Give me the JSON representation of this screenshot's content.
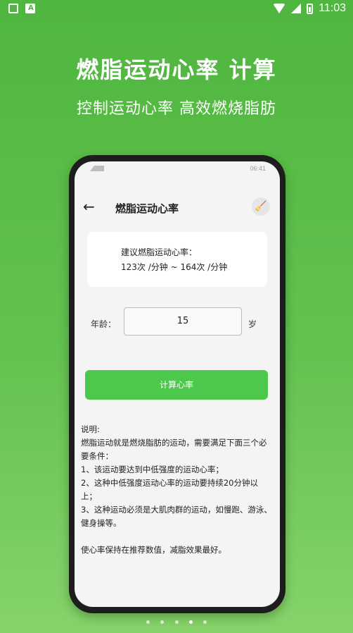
{
  "device": {
    "time": "11:03",
    "icons": [
      "cat-icon",
      "a-icon",
      "wifi-icon",
      "signal-icon",
      "battery-icon"
    ]
  },
  "banner": {
    "headline": "燃脂运动心率  计算",
    "subline": "控制运动心率    高效燃烧脂肪"
  },
  "phone": {
    "status_time": "06:41",
    "title": "燃脂运动心率",
    "suggest_label": "建议燃脂运动心率：",
    "suggest_value": "123次 /分钟 ~ 164次 /分钟",
    "age_label": "年龄：",
    "age_value": "15",
    "age_unit": "岁",
    "calc_button": "计算心率",
    "desc": [
      "说明:",
      "燃脂运动就是燃烧脂肪的运动，需要满足下面三个必要条件：",
      "1、该运动要达到中低强度的运动心率；",
      "2、这种中低强度运动心率的运动要持续20分钟以上；",
      "3、这种运动必须是大肌肉群的运动，如慢跑、游泳、健身操等。",
      "使心率保持在推荐数值，减脂效果最好。"
    ]
  },
  "pager": {
    "count": 5,
    "active": 4
  }
}
